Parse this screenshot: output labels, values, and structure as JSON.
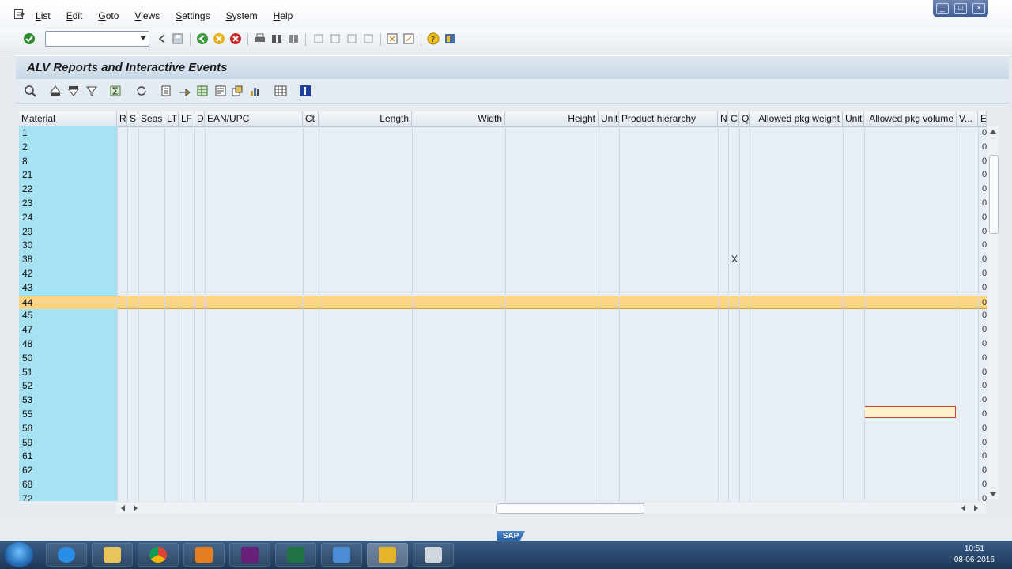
{
  "menubar": {
    "items": [
      "List",
      "Edit",
      "Goto",
      "Views",
      "Settings",
      "System",
      "Help"
    ]
  },
  "window": {
    "title": "ALV Reports and Interactive Events"
  },
  "grid": {
    "columns": [
      {
        "label": "Material"
      },
      {
        "label": "R"
      },
      {
        "label": "S"
      },
      {
        "label": "Seas"
      },
      {
        "label": "LT"
      },
      {
        "label": "LF"
      },
      {
        "label": "D"
      },
      {
        "label": "EAN/UPC"
      },
      {
        "label": "Ct"
      },
      {
        "label": "Length"
      },
      {
        "label": "Width"
      },
      {
        "label": "Height"
      },
      {
        "label": "Unit"
      },
      {
        "label": "Product hierarchy"
      },
      {
        "label": "N"
      },
      {
        "label": "C"
      },
      {
        "label": "Q"
      },
      {
        "label": "Allowed pkg weight"
      },
      {
        "label": "Unit"
      },
      {
        "label": "Allowed pkg volume"
      },
      {
        "label": "V..."
      },
      {
        "label": "E"
      }
    ],
    "rows": [
      "1",
      "2",
      "8",
      "21",
      "22",
      "23",
      "24",
      "29",
      "30",
      "38",
      "42",
      "43",
      "44",
      "45",
      "47",
      "48",
      "50",
      "51",
      "52",
      "53",
      "55",
      "58",
      "59",
      "61",
      "62",
      "68",
      "72"
    ],
    "selected_row": "44",
    "x_mark_row": "38",
    "x_mark": "X",
    "edge_value": "0"
  },
  "footer": {
    "logo": "SAP"
  },
  "taskbar": {
    "time": "10:51",
    "date": "08-06-2016"
  }
}
